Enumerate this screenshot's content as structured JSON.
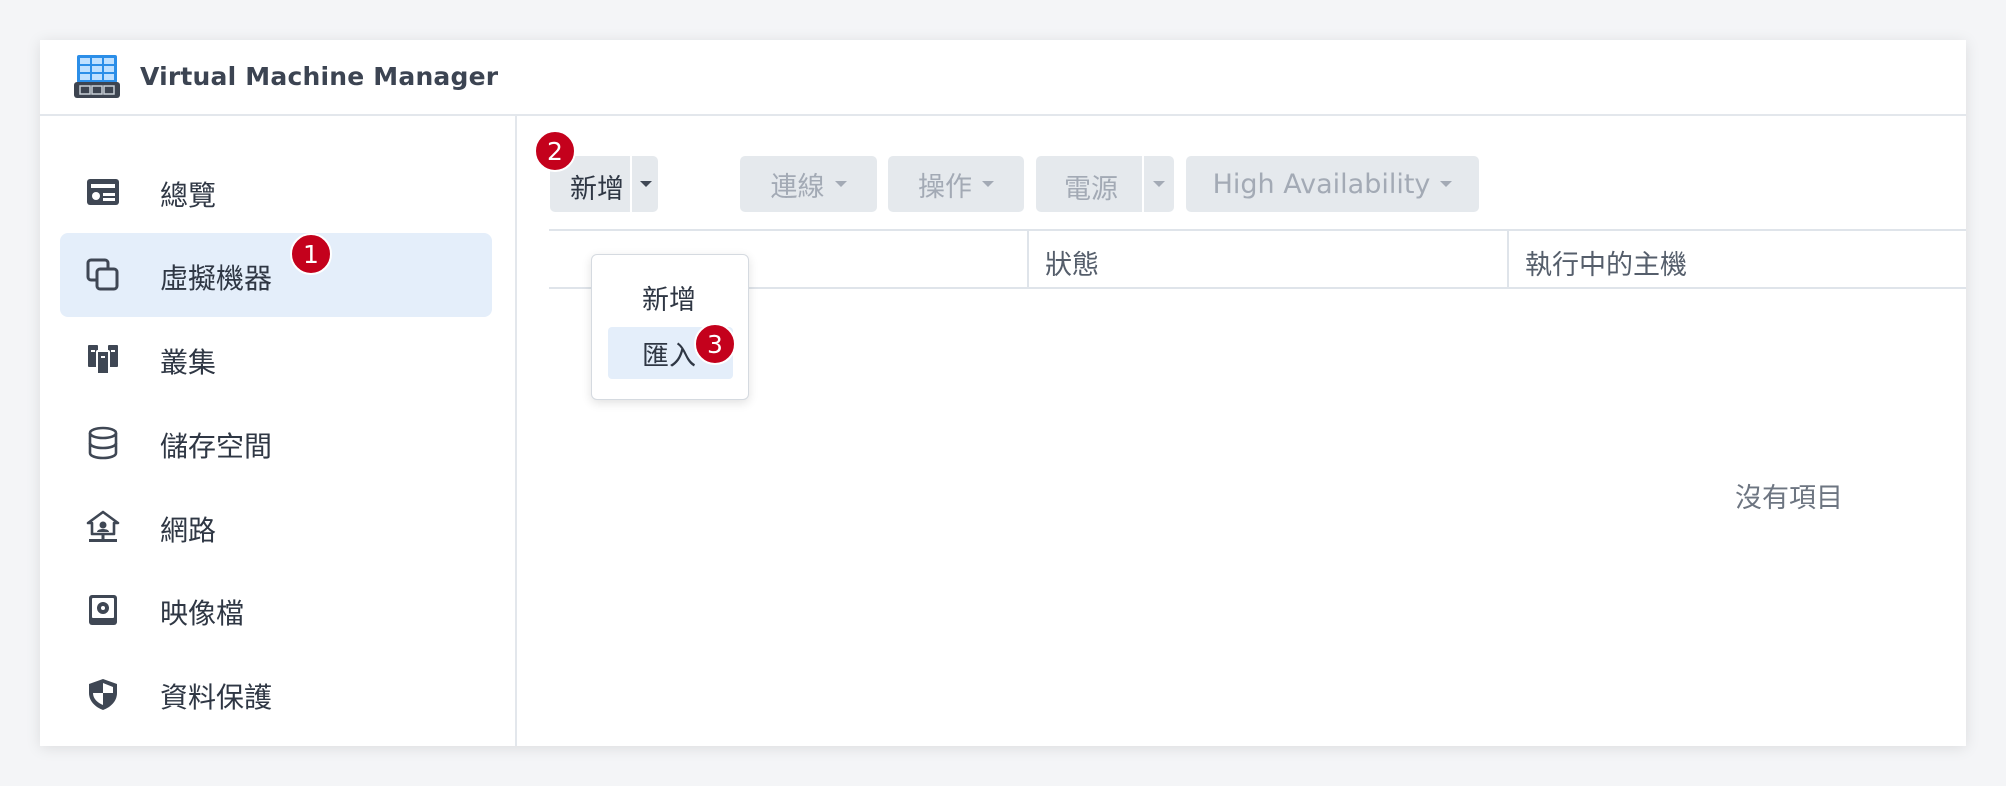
{
  "window": {
    "title": "Virtual Machine Manager",
    "app_icon": "vmm-app-icon"
  },
  "sidebar": {
    "items": [
      {
        "label": "總覽",
        "icon": "overview-icon"
      },
      {
        "label": "虛擬機器",
        "icon": "virtual-machine-icon",
        "active": true
      },
      {
        "label": "叢集",
        "icon": "cluster-icon"
      },
      {
        "label": "儲存空間",
        "icon": "storage-icon"
      },
      {
        "label": "網路",
        "icon": "network-icon"
      },
      {
        "label": "映像檔",
        "icon": "image-icon"
      },
      {
        "label": "資料保護",
        "icon": "shield-icon"
      }
    ]
  },
  "toolbar": {
    "create_label": "新增",
    "connect_label": "連線",
    "action_label": "操作",
    "power_label": "電源",
    "ha_label": "High Availability"
  },
  "dropdown": {
    "items": [
      {
        "label": "新增"
      },
      {
        "label": "匯入",
        "highlighted": true
      }
    ]
  },
  "table": {
    "columns": [
      "狀態",
      "執行中的主機"
    ],
    "empty_text": "沒有項目"
  },
  "annotations": {
    "badge1": "1",
    "badge2": "2",
    "badge3": "3"
  },
  "colors": {
    "accent_bg": "#e4eefa",
    "badge_red": "#c4011c",
    "button_bg": "#e5e9ed"
  }
}
